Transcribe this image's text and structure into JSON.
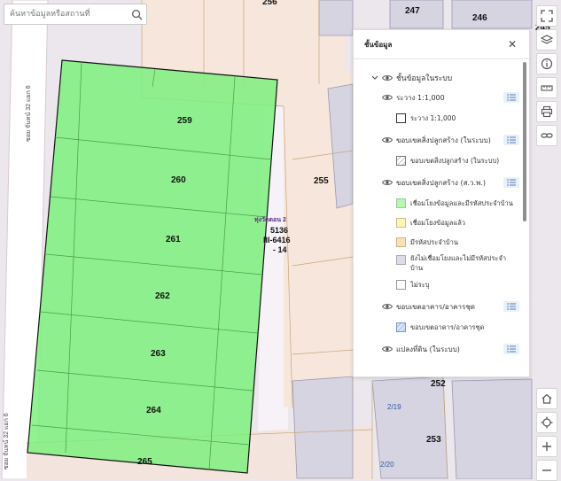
{
  "search": {
    "placeholder": "ค้นหาข้อมูลหรือสถานที่"
  },
  "map": {
    "parcels": [
      "259",
      "260",
      "261",
      "262",
      "263",
      "264",
      "265"
    ],
    "other_parcels": [
      "256",
      "247",
      "246",
      "245",
      "255",
      "252",
      "253"
    ],
    "road_left": "ซอย จันทน์ 32 แยก 6",
    "road_left_bottom": "ซอย จันทน์ 32 แยก 6",
    "poi": "ทุ่งวัดดอน 2",
    "plot_code": [
      "5136",
      "III-6416",
      "- 14"
    ],
    "map_sheet": [
      "2/19",
      "2/20"
    ],
    "highlight_color": "#7ef07e"
  },
  "panel": {
    "title": "ชั้นข้อมูล",
    "group": "ชั้นข้อมูลในระบบ",
    "layers": [
      {
        "label": "ระวาง 1:1,000",
        "items": [
          {
            "label": "ระวาง 1:1,000",
            "color": "#ffffff",
            "hatch": false,
            "border": "#333333"
          }
        ]
      },
      {
        "label": "ขอบเขตสิ่งปลูกสร้าง (ในระบบ)",
        "items": [
          {
            "label": "ขอบเขตสิ่งปลูกสร้าง (ในระบบ)",
            "color": "#ffffff",
            "hatch": true,
            "border": "#777777"
          }
        ]
      },
      {
        "label": "ขอบเขตสิ่งปลูกสร้าง (ส.ว.พ.)",
        "items": [
          {
            "label": "เชื่อมโยงข้อมูลและมีรหัสประจำบ้าน",
            "color": "#b8f5b0",
            "hatch": false,
            "border": "#9ac99a"
          },
          {
            "label": "เชื่อมโยงข้อมูลแล้ว",
            "color": "#fff6b8",
            "hatch": false,
            "border": "#c8c08a"
          },
          {
            "label": "มีรหัสประจำบ้าน",
            "color": "#fbe2b6",
            "hatch": false,
            "border": "#cdb28a"
          },
          {
            "label": "ยังไม่เชื่อมโยงและไม่มีรหัสประจำบ้าน",
            "color": "#dcdce6",
            "hatch": false,
            "border": "#a9a9b8"
          },
          {
            "label": "ไม่ระบุ",
            "color": "#ffffff",
            "hatch": false,
            "border": "#999999"
          }
        ]
      },
      {
        "label": "ขอบเขตอาคาร/อาคารชุด",
        "items": [
          {
            "label": "ขอบเขตอาคาร/อาคารชุด",
            "color": "#d8e6fa",
            "hatch": true,
            "border": "#7a98c8"
          }
        ]
      },
      {
        "label": "แปลงที่ดิน (ในระบบ)",
        "items": []
      }
    ]
  },
  "toolbar": {
    "top": [
      "fullscreen-icon",
      "layers-icon",
      "info-icon",
      "measure-icon",
      "print-icon",
      "link-icon"
    ],
    "bottom": [
      "home-icon",
      "locate-icon",
      "zoom-in-icon",
      "zoom-out-icon"
    ]
  }
}
